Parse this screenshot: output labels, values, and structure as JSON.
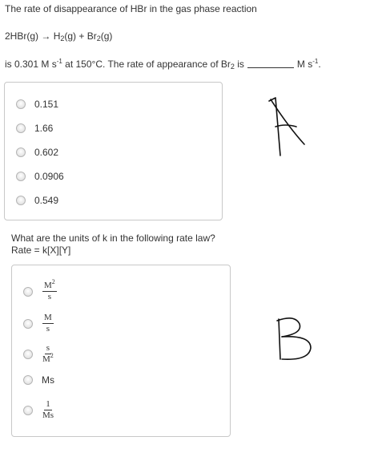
{
  "q1": {
    "line1": "The rate of disappearance of HBr in the gas phase reaction",
    "reaction_lhs": "2HBr(g)",
    "arrow": "→",
    "h_prefix": "H",
    "h_sub": "2",
    "h_suffix": "(g) + Br",
    "br_sub": "2",
    "br_suffix": "(g)",
    "line3_a": "is 0.301 M s",
    "sup_a": "-1",
    "line3_b": " at 150°C. The rate of appearance of Br",
    "line3_sub": "2",
    "line3_c": " is",
    "line3_d": "M s",
    "sup_b": "-1",
    "line3_e": ".",
    "options": [
      "0.151",
      "1.66",
      "0.602",
      "0.0906",
      "0.549"
    ]
  },
  "q2": {
    "line1": "What are the units of k in the following rate law?",
    "line2": "Rate = k[X][Y]",
    "options": [
      {
        "num": "M",
        "num_sup": "2",
        "den": "s",
        "den_sup": ""
      },
      {
        "num": "M",
        "num_sup": "",
        "den": "s",
        "den_sup": ""
      },
      {
        "num": "s",
        "num_sup": "",
        "den": "M",
        "den_sup": "2"
      },
      {
        "text": "Ms"
      },
      {
        "num": "1",
        "num_sup": "",
        "den": "Ms",
        "den_sup": ""
      }
    ]
  },
  "annotations": {
    "a": "A",
    "b": "B"
  }
}
